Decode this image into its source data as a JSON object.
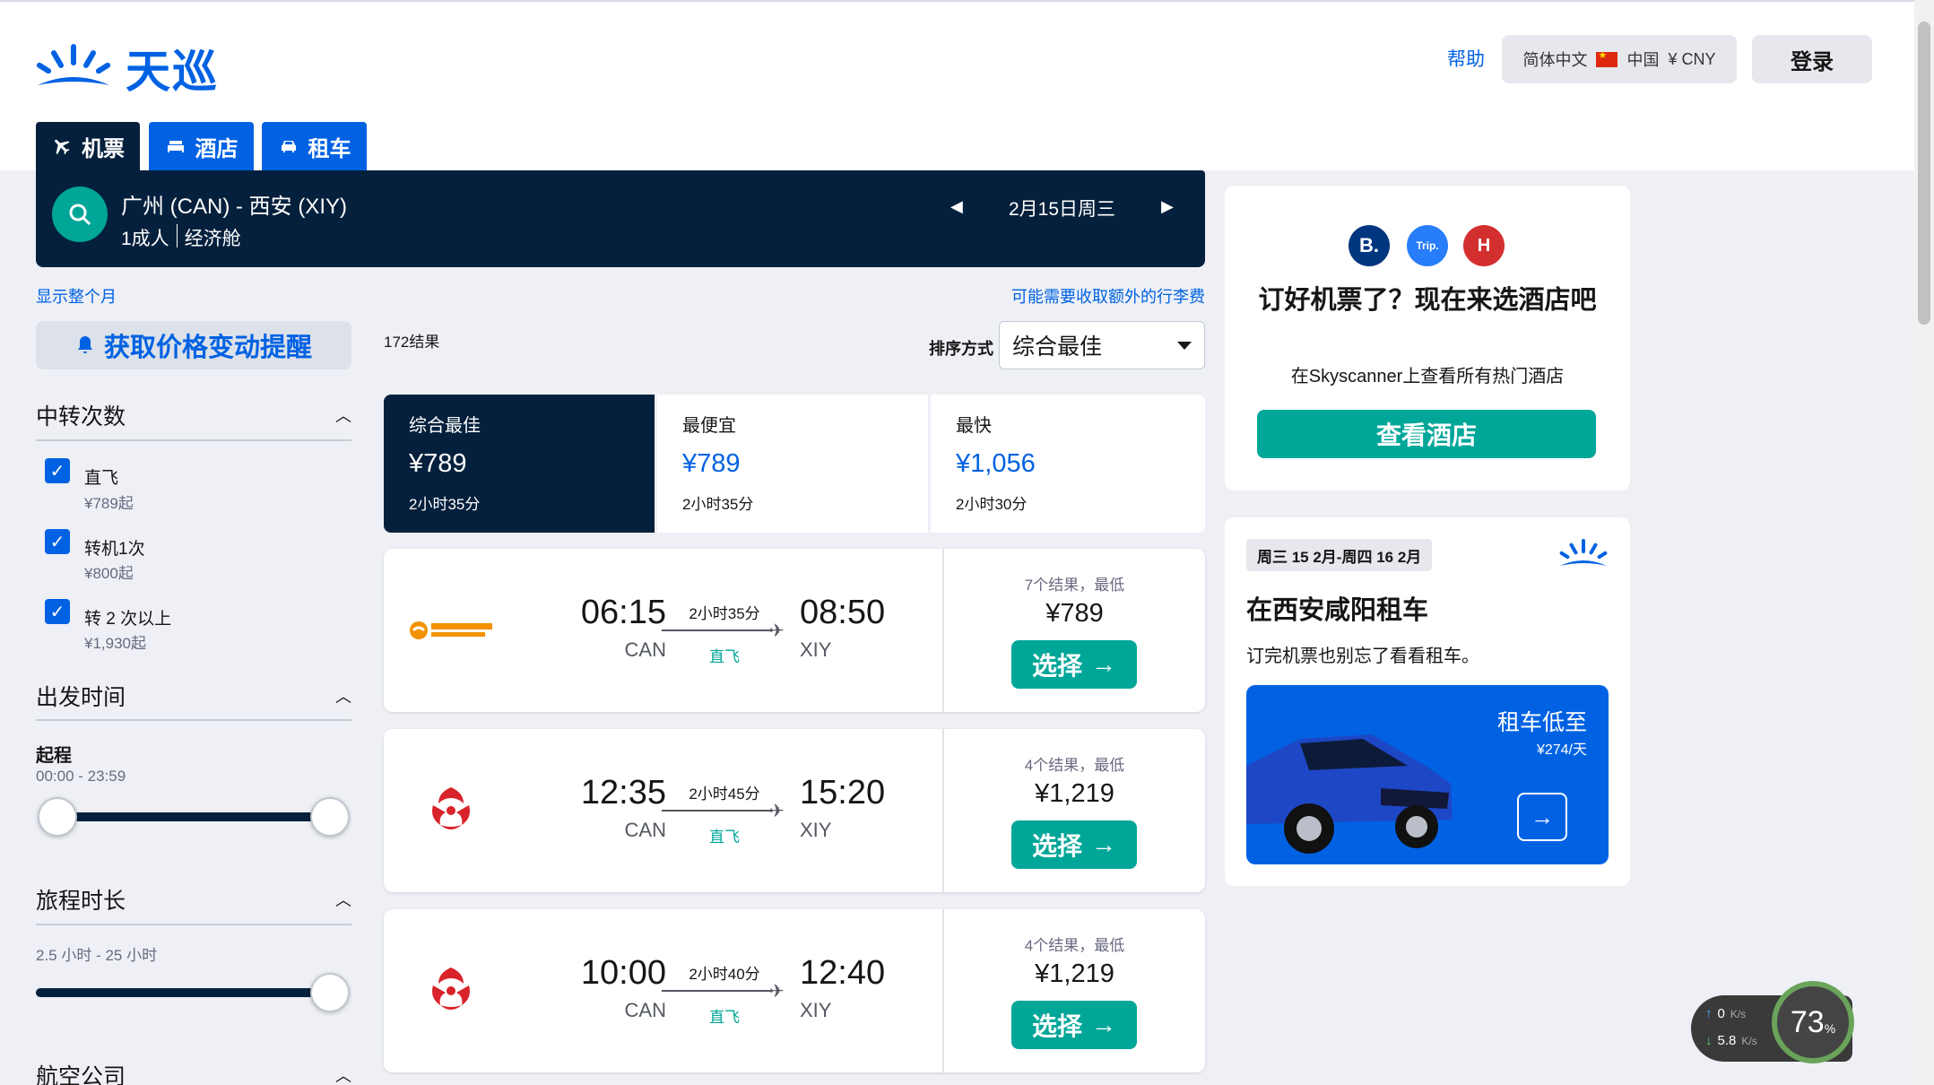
{
  "brand": {
    "name": "天巡"
  },
  "header": {
    "help": "帮助",
    "language": "简体中文",
    "region": "中国",
    "currency": "¥ CNY",
    "login": "登录"
  },
  "tabs": [
    {
      "label": "机票",
      "icon": "plane-icon"
    },
    {
      "label": "酒店",
      "icon": "bed-icon"
    },
    {
      "label": "租车",
      "icon": "car-icon"
    }
  ],
  "search": {
    "route": "广州 (CAN) - 西安 (XIY)",
    "passengers": "1成人",
    "cabin": "经济舱",
    "date": "2月15日周三"
  },
  "links": {
    "show_month": "显示整个月",
    "fees_note": "可能需要收取额外的行李费"
  },
  "price_alert": "获取价格变动提醒",
  "filters": {
    "stops": {
      "title": "中转次数",
      "options": [
        {
          "label": "直飞",
          "price": "¥789起",
          "checked": true
        },
        {
          "label": "转机1次",
          "price": "¥800起",
          "checked": true
        },
        {
          "label": "转 2 次以上",
          "price": "¥1,930起",
          "checked": true
        }
      ]
    },
    "departure": {
      "title": "出发时间",
      "sub_title": "起程",
      "range": "00:00 - 23:59",
      "range_fraction": [
        0,
        1
      ]
    },
    "duration": {
      "title": "旅程时长",
      "range": "2.5 小时 - 25 小时",
      "range_fraction": [
        0,
        1
      ]
    },
    "airlines": {
      "title": "航空公司"
    }
  },
  "results": {
    "count": "172结果",
    "sort_label": "排序方式",
    "sort_value": "综合最佳"
  },
  "sort_tabs": [
    {
      "title": "综合最佳",
      "price": "¥789",
      "duration": "2小时35分",
      "active": true
    },
    {
      "title": "最便宜",
      "price": "¥789",
      "duration": "2小时35分",
      "active": false
    },
    {
      "title": "最快",
      "price": "¥1,056",
      "duration": "2小时30分",
      "active": false
    }
  ],
  "flights": [
    {
      "airline_logo": "jiangxi-air-logo",
      "dep_time": "06:15",
      "dep_code": "CAN",
      "duration": "2小时35分",
      "stops": "直飞",
      "arr_time": "08:50",
      "arr_code": "XIY",
      "offers": "7个结果，最低",
      "price": "¥789",
      "select": "选择"
    },
    {
      "airline_logo": "hainan-airlines-logo",
      "dep_time": "12:35",
      "dep_code": "CAN",
      "duration": "2小时45分",
      "stops": "直飞",
      "arr_time": "15:20",
      "arr_code": "XIY",
      "offers": "4个结果，最低",
      "price": "¥1,219",
      "select": "选择"
    },
    {
      "airline_logo": "hainan-airlines-logo",
      "dep_time": "10:00",
      "dep_code": "CAN",
      "duration": "2小时40分",
      "stops": "直飞",
      "arr_time": "12:40",
      "arr_code": "XIY",
      "offers": "4个结果，最低",
      "price": "¥1,219",
      "select": "选择"
    }
  ],
  "hotel_promo": {
    "partners": [
      "B.",
      "Trip.",
      "H"
    ],
    "title": "订好机票了？现在来选酒店吧",
    "subtitle": "在Skyscanner上查看所有热门酒店",
    "button": "查看酒店"
  },
  "car_promo": {
    "dates": "周三 15 2月-周四 16 2月",
    "title": "在西安咸阳租车",
    "subtitle": "订完机票也别忘了看看租车。",
    "banner_title": "租车低至",
    "banner_price": "¥274/天"
  },
  "net_widget": {
    "upload_value": "0",
    "upload_unit": "K/s",
    "download_value": "5.8",
    "download_unit": "K/s",
    "percent": "73",
    "percent_unit": "%"
  },
  "colors": {
    "navy": "#05203c",
    "blue": "#0062e3",
    "teal": "#00a698"
  }
}
